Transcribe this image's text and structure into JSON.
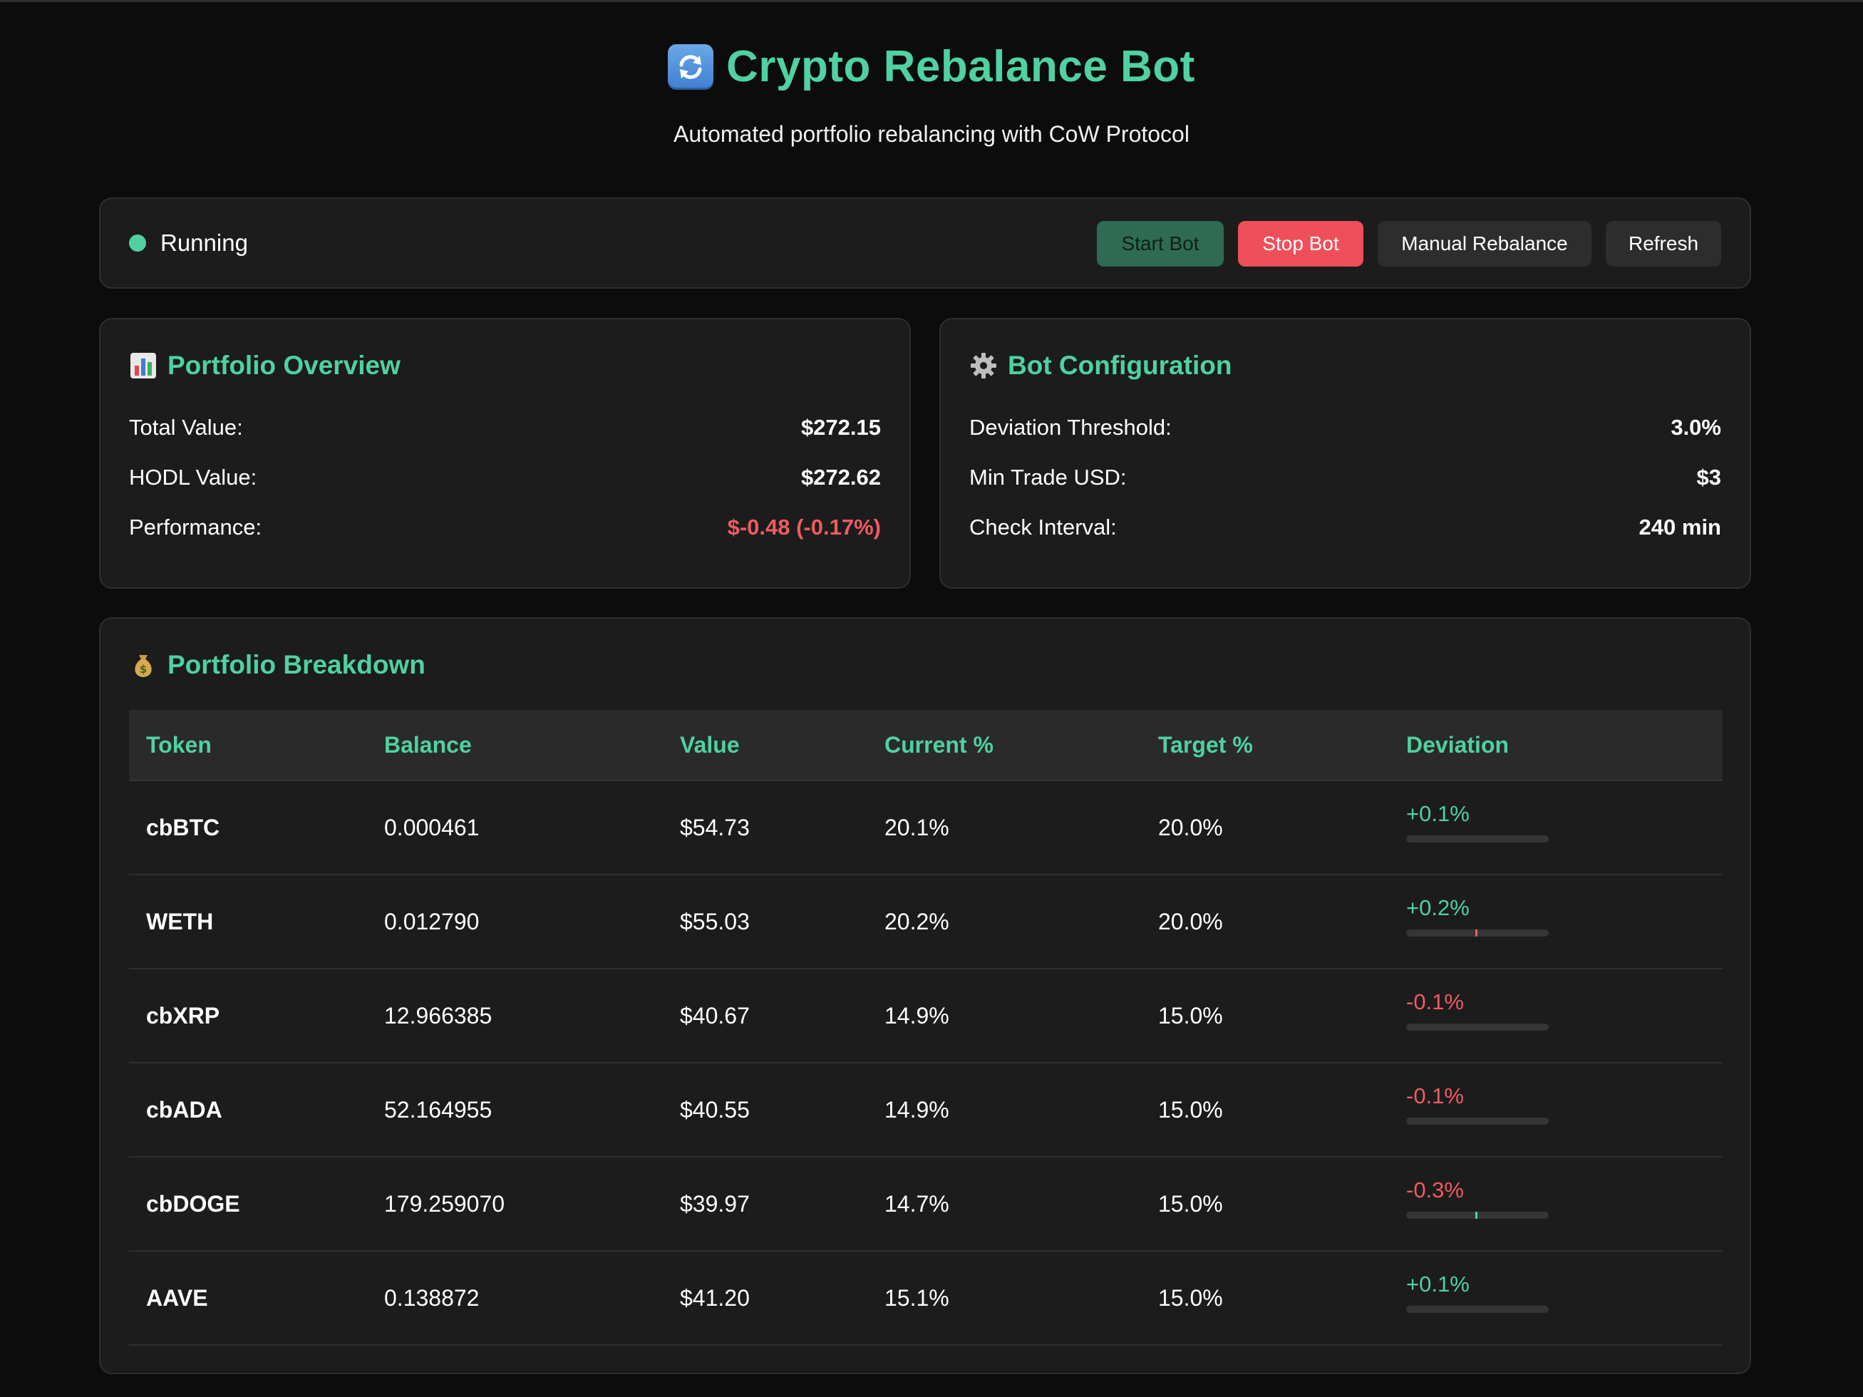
{
  "app": {
    "title": "Crypto Rebalance Bot",
    "subtitle": "Automated portfolio rebalancing with CoW Protocol",
    "title_icon": "refresh-arrows-icon"
  },
  "status": {
    "label": "Running",
    "indicator_color": "#4fd1a1"
  },
  "controls": {
    "start_label": "Start Bot",
    "stop_label": "Stop Bot",
    "manual_label": "Manual Rebalance",
    "refresh_label": "Refresh"
  },
  "overview": {
    "title": "Portfolio Overview",
    "icon": "bar-chart-icon",
    "rows": [
      {
        "label": "Total Value:",
        "value": "$272.15"
      },
      {
        "label": "HODL Value:",
        "value": "$272.62"
      },
      {
        "label": "Performance:",
        "value": "$-0.48 (-0.17%)"
      }
    ]
  },
  "config": {
    "title": "Bot Configuration",
    "icon": "gear-icon",
    "rows": [
      {
        "label": "Deviation Threshold:",
        "value": "3.0%"
      },
      {
        "label": "Min Trade USD:",
        "value": "$3"
      },
      {
        "label": "Check Interval:",
        "value": "240 min"
      }
    ]
  },
  "breakdown": {
    "title": "Portfolio Breakdown",
    "icon": "money-bag-icon",
    "columns": [
      "Token",
      "Balance",
      "Value",
      "Current %",
      "Target %",
      "Deviation"
    ],
    "rows": [
      {
        "token": "cbBTC",
        "balance": "0.000461",
        "value": "$54.73",
        "current": "20.1%",
        "target": "20.0%",
        "deviation": "+0.1%",
        "sign": "pos",
        "tick_color": ""
      },
      {
        "token": "WETH",
        "balance": "0.012790",
        "value": "$55.03",
        "current": "20.2%",
        "target": "20.0%",
        "deviation": "+0.2%",
        "sign": "pos",
        "tick_color": "#ef5b61"
      },
      {
        "token": "cbXRP",
        "balance": "12.966385",
        "value": "$40.67",
        "current": "14.9%",
        "target": "15.0%",
        "deviation": "-0.1%",
        "sign": "neg",
        "tick_color": ""
      },
      {
        "token": "cbADA",
        "balance": "52.164955",
        "value": "$40.55",
        "current": "14.9%",
        "target": "15.0%",
        "deviation": "-0.1%",
        "sign": "neg",
        "tick_color": ""
      },
      {
        "token": "cbDOGE",
        "balance": "179.259070",
        "value": "$39.97",
        "current": "14.7%",
        "target": "15.0%",
        "deviation": "-0.3%",
        "sign": "neg",
        "tick_color": "#4fd1a1"
      },
      {
        "token": "AAVE",
        "balance": "0.138872",
        "value": "$41.20",
        "current": "15.1%",
        "target": "15.0%",
        "deviation": "+0.1%",
        "sign": "pos",
        "tick_color": ""
      }
    ]
  }
}
